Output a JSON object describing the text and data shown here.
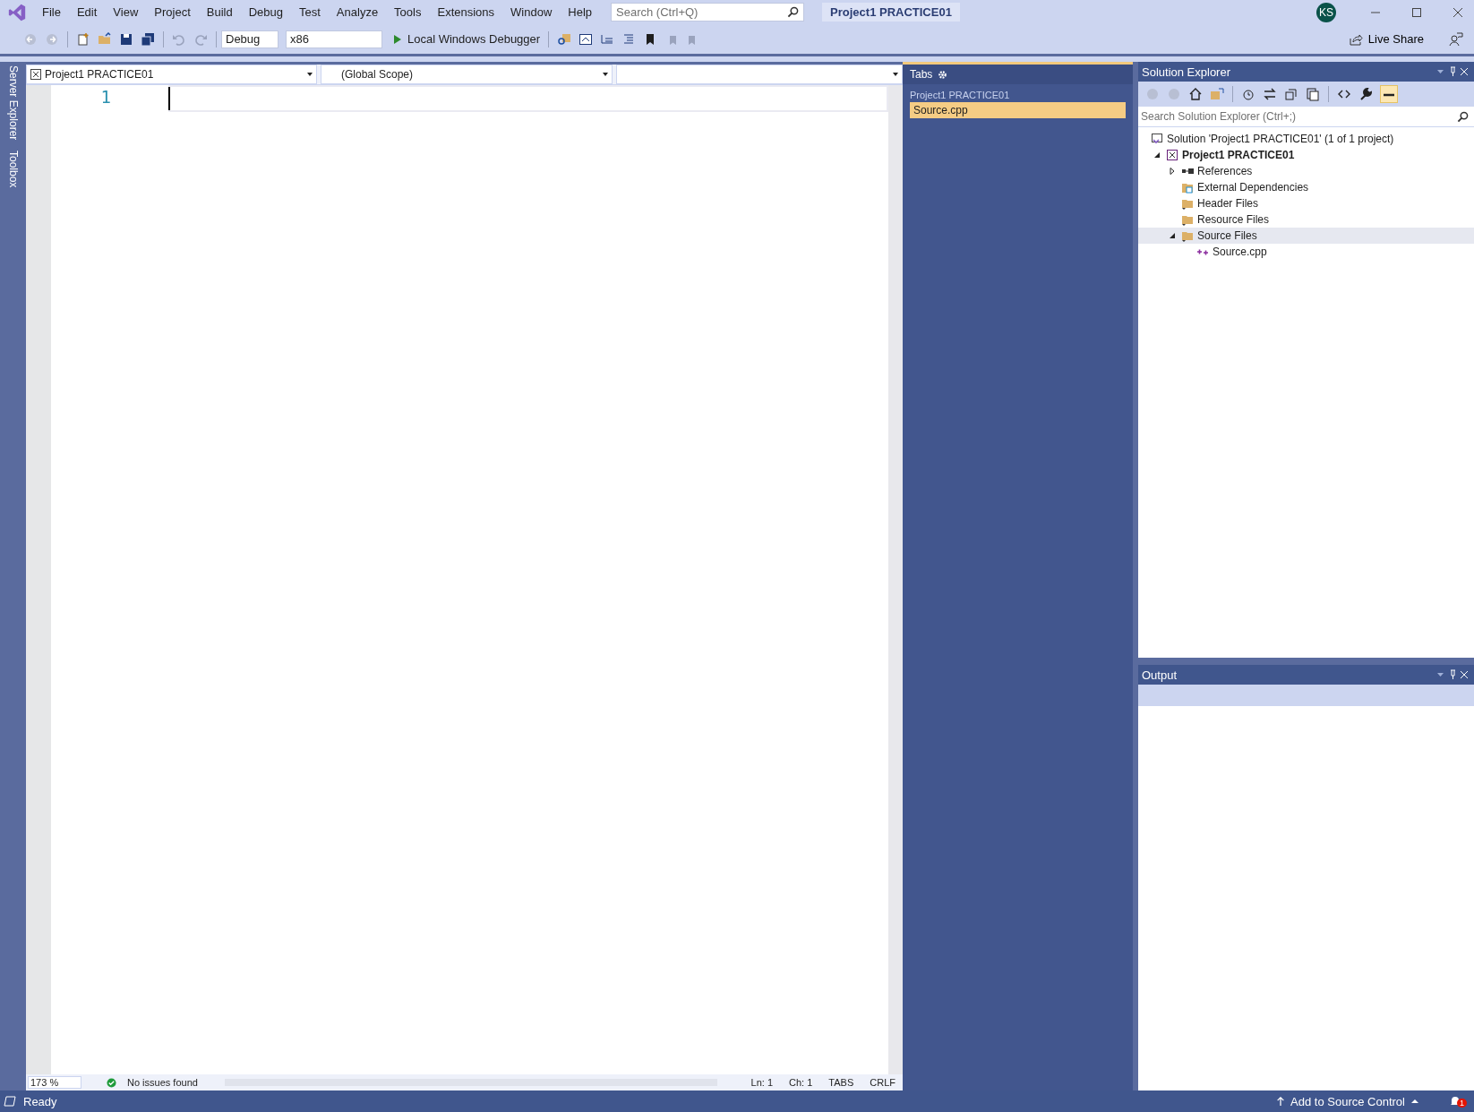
{
  "menu": [
    "File",
    "Edit",
    "View",
    "Project",
    "Build",
    "Debug",
    "Test",
    "Analyze",
    "Tools",
    "Extensions",
    "Window",
    "Help"
  ],
  "search": {
    "placeholder": "Search (Ctrl+Q)"
  },
  "window": {
    "title": "Project1 PRACTICE01",
    "avatar": "KS"
  },
  "toolbar": {
    "configuration": "Debug",
    "platform": "x86",
    "run": "Local Windows Debugger",
    "live_share": "Live Share"
  },
  "side_tabs": [
    "Server Explorer",
    "Toolbox"
  ],
  "editor": {
    "project": "Project1 PRACTICE01",
    "scope": "(Global Scope)",
    "line_numbers": [
      "1"
    ],
    "status": {
      "zoom": "173 %",
      "issues": "No issues found",
      "line": "Ln: 1",
      "column": "Ch: 1",
      "indent": "TABS",
      "line_ending": "CRLF"
    }
  },
  "tabs_panel": {
    "title": "Tabs",
    "group": "Project1 PRACTICE01",
    "items": [
      {
        "label": "Source.cpp",
        "selected": true
      }
    ]
  },
  "solution_explorer": {
    "title": "Solution Explorer",
    "search": {
      "placeholder": "Search Solution Explorer (Ctrl+;)"
    },
    "tree": [
      {
        "label": "Solution 'Project1 PRACTICE01' (1 of 1 project)",
        "kind": "solution",
        "selected": false,
        "children": [
          {
            "label": "Project1 PRACTICE01",
            "kind": "project",
            "bold": true,
            "expanded": true,
            "selected": false,
            "children": [
              {
                "label": "References",
                "kind": "references",
                "expanded": false,
                "selected": false
              },
              {
                "label": "External Dependencies",
                "kind": "external",
                "selected": false
              },
              {
                "label": "Header Files",
                "kind": "folder",
                "selected": false
              },
              {
                "label": "Resource Files",
                "kind": "folder",
                "selected": false
              },
              {
                "label": "Source Files",
                "kind": "folder",
                "expanded": true,
                "selected": true,
                "children": [
                  {
                    "label": "Source.cpp",
                    "kind": "cpp",
                    "selected": false
                  }
                ]
              }
            ]
          }
        ]
      }
    ]
  },
  "output": {
    "title": "Output"
  },
  "status_bar": {
    "state": "Ready",
    "source_control": "Add to Source Control",
    "notifications": "1"
  }
}
